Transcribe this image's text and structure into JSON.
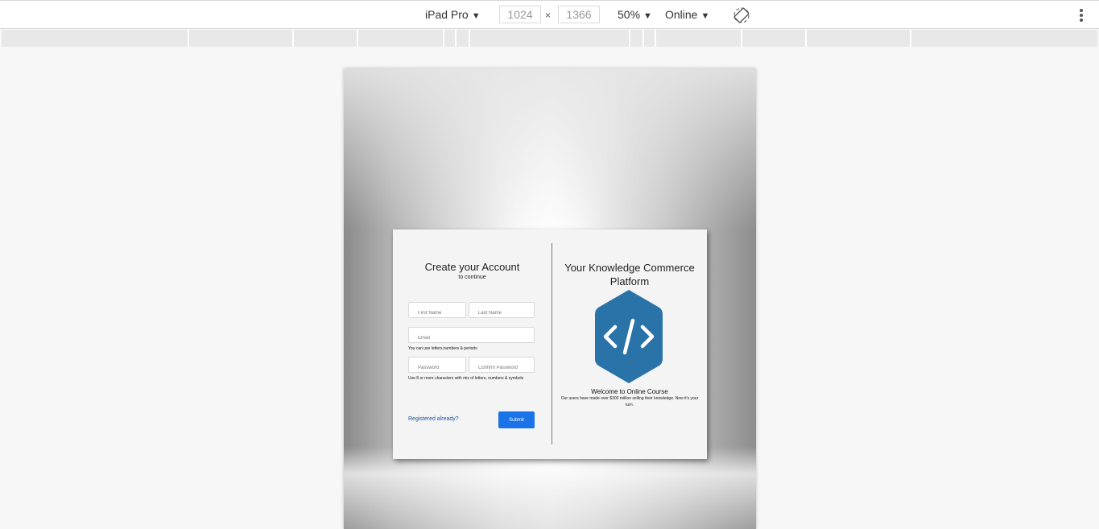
{
  "toolbar": {
    "device": "iPad Pro",
    "width": "1024",
    "height": "1366",
    "times": "×",
    "zoom": "50%",
    "network": "Online"
  },
  "form": {
    "title": "Create your Account",
    "subtitle": "to continue",
    "first_name_placeholder": "First Name",
    "last_name_placeholder": "Last Name",
    "email_placeholder": "Email",
    "email_hint": "You can use letters,numbers & periods",
    "password_placeholder": "Password",
    "confirm_placeholder": "Confirm Password",
    "password_hint": "Use 8 or more characters with mix of letters, numbers & symbols",
    "registered_link": "Registered already?",
    "submit_label": "Submit"
  },
  "promo": {
    "title": "Your Knowledge Commerce Platform",
    "welcome": "Welcome to Online Course",
    "description": "Our users have made over $300 million selling their knowledge. Now it's your turn.",
    "logo_icon": "code-brackets-icon",
    "logo_color": "#2a73a8"
  }
}
